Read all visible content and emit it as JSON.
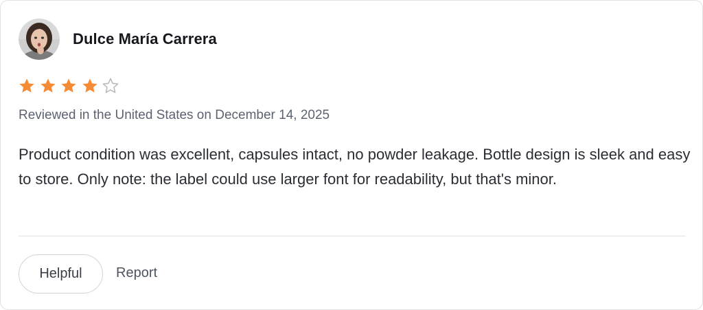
{
  "review": {
    "reviewer_name": "Dulce María Carrera",
    "avatar_icon": "avatar-photo",
    "rating": 4,
    "rating_max": 5,
    "star_color": "#f58b34",
    "star_empty_color": "#b9b9b9",
    "meta": "Reviewed in the United States on December 14, 2025",
    "body": "Product condition was excellent, capsules intact, no powder leakage. Bottle design is sleek and easy to store. Only note: the label could use larger font for readability, but that's minor."
  },
  "actions": {
    "helpful_label": "Helpful",
    "report_label": "Report"
  }
}
